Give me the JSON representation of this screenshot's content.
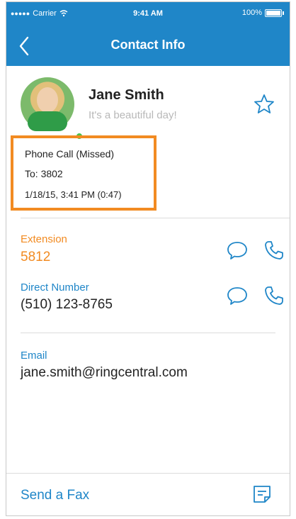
{
  "status_bar": {
    "carrier": "Carrier",
    "time": "9:41 AM",
    "battery": "100%"
  },
  "nav": {
    "title": "Contact Info"
  },
  "contact": {
    "name": "Jane Smith",
    "status_message": "It's a beautiful day!",
    "presence": "online"
  },
  "call": {
    "type": "Phone Call (Missed)",
    "to": "To: 3802",
    "datetime": "1/18/15, 3:41 PM (0:47)"
  },
  "fields": {
    "extension": {
      "label": "Extension",
      "value": "5812"
    },
    "direct": {
      "label": "Direct Number",
      "value": "(510) 123-8765"
    },
    "email": {
      "label": "Email",
      "value": "jane.smith@ringcentral.com"
    }
  },
  "footer": {
    "send_fax": "Send a Fax"
  },
  "colors": {
    "brand_blue": "#1f86c8",
    "accent_orange": "#f28b22",
    "highlight_border": "#f28b22"
  },
  "icons": {
    "back": "chevron-left-icon",
    "favorite": "star-icon",
    "message": "chat-bubble-icon",
    "call": "phone-icon",
    "fax": "fax-icon"
  }
}
